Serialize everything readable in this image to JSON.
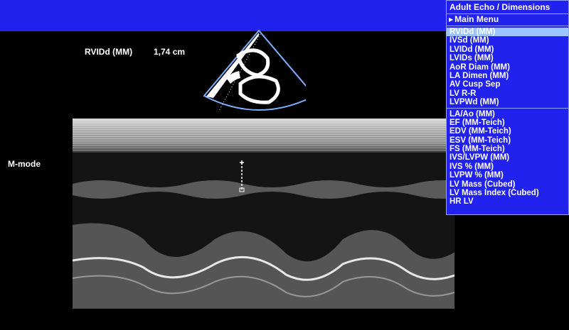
{
  "measurement": {
    "label": "RVIDd (MM)",
    "value": "1,74 cm"
  },
  "mode_label": "M-mode",
  "menu": {
    "title": "Adult Echo / Dimensions",
    "main_menu": "Main Menu",
    "group1": [
      "RVIDd (MM)",
      "IVSd (MM)",
      "LVIDd (MM)",
      "LVIDs (MM)",
      "AoR Diam (MM)",
      "LA Dimen (MM)",
      "AV Cusp Sep",
      "LV R-R",
      "LVPWd (MM)"
    ],
    "group2": [
      "LA/Ao (MM)",
      "EF (MM-Teich)",
      "EDV (MM-Teich)",
      "ESV (MM-Teich)",
      "FS (MM-Teich)",
      "IVS/LVPW (MM)",
      "IVS % (MM)",
      "LVPW % (MM)",
      "LV Mass (Cubed)",
      "LV Mass Index (Cubed)",
      "HR LV"
    ],
    "selected_item": "RVIDd (MM)"
  },
  "colors": {
    "bar": "#2222ee",
    "menu_bg": "#2222ee",
    "selected_bg": "#9cc4ff",
    "sector_outline": "#7fb0ff"
  },
  "icons": {
    "submenu_arrow": "triangle-right-icon",
    "caliper": "caliper-marker-icon"
  }
}
